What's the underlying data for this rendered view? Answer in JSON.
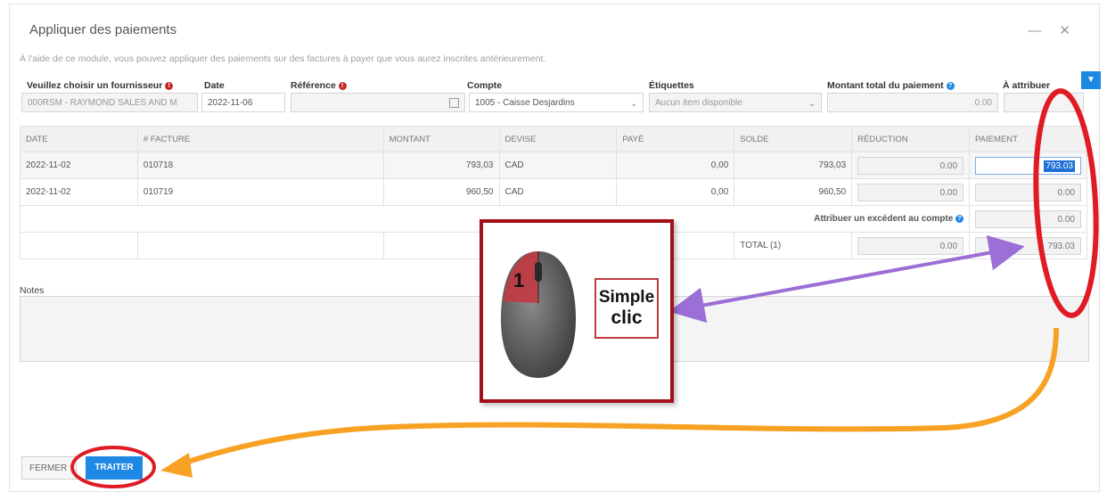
{
  "dialog": {
    "title": "Appliquer des paiements",
    "window_controls": "— ✕",
    "intro": "À l'aide de ce module, vous pouvez appliquer des paiements sur des factures à payer que vous aurez inscrites antérieurement."
  },
  "form": {
    "supplier_label": "Veuillez choisir un fournisseur",
    "supplier_value": "000RSM - RAYMOND SALES AND M",
    "date_label": "Date",
    "date_value": "2022-11-06",
    "reference_label": "Référence",
    "reference_value": "",
    "account_label": "Compte",
    "account_value": "1005 - Caisse Desjardins",
    "tags_label": "Étiquettes",
    "tags_placeholder": "Aucun item disponible",
    "total_label": "Montant total du paiement",
    "total_value": "0.00",
    "assign_label": "À attribuer"
  },
  "table": {
    "headers": [
      "DATE",
      "# FACTURE",
      "MONTANT",
      "DEVISE",
      "PAYÉ",
      "SOLDE",
      "RÉDUCTION",
      "PAIEMENT"
    ],
    "rows": [
      {
        "date": "2022-11-02",
        "invoice": "010718",
        "amount": "793,03",
        "currency": "CAD",
        "paid": "0,00",
        "balance": "793,03",
        "reduction": "0.00",
        "payment": "793.03"
      },
      {
        "date": "2022-11-02",
        "invoice": "010719",
        "amount": "960,50",
        "currency": "CAD",
        "paid": "0,00",
        "balance": "960,50",
        "reduction": "0.00",
        "payment": "0.00"
      }
    ],
    "excess_label": "Attribuer un excédent au compte",
    "excess_value": "0.00",
    "total_label": "TOTAL (1)",
    "total_reduction": "0.00",
    "total_payment": "793.03"
  },
  "notes": {
    "label": "Notes"
  },
  "buttons": {
    "close": "FERMER",
    "process": "TRAITER"
  },
  "annotation": {
    "mouse_button_number": "1",
    "caption_line1": "Simple",
    "caption_line2": "clic"
  },
  "colors": {
    "accent_blue": "#1e88e5",
    "annotation_red": "#e01b24",
    "arrow_purple": "#9b6fd6",
    "arrow_orange": "#f7a224",
    "frame_dark_red": "#a3101a"
  }
}
